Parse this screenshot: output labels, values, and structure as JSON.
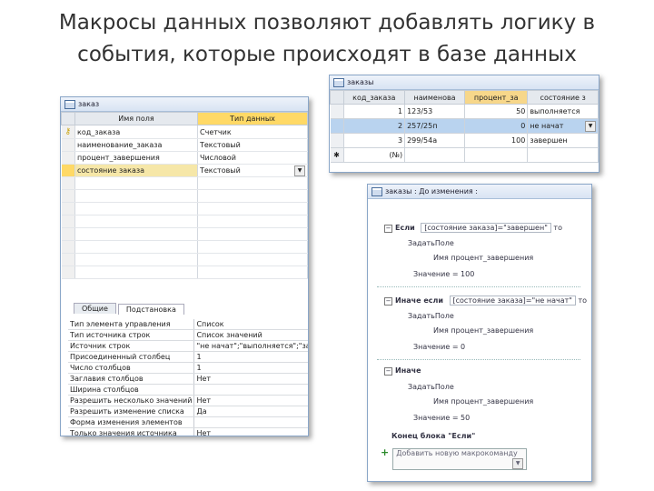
{
  "slide": {
    "title_line1": "Макросы данных позволяют добавлять логику в",
    "title_line2": "события, которые происходят в базе данных"
  },
  "design_view": {
    "title": "заказ",
    "col_field": "Имя поля",
    "col_type": "Тип данных",
    "rows": [
      {
        "field": "код_заказа",
        "type": "Счетчик"
      },
      {
        "field": "наименование_заказа",
        "type": "Текстовый"
      },
      {
        "field": "процент_завершения",
        "type": "Числовой"
      },
      {
        "field": "состояние заказа",
        "type": "Текстовый"
      }
    ],
    "tab_general": "Общие",
    "tab_lookup": "Подстановка",
    "properties": [
      {
        "name": "Тип элемента управления",
        "value": "Список"
      },
      {
        "name": "Тип источника строк",
        "value": "Список значений"
      },
      {
        "name": "Источник строк",
        "value": "\"не начат\";\"выполняется\";\"завершен\""
      },
      {
        "name": "Присоединенный столбец",
        "value": "1"
      },
      {
        "name": "Число столбцов",
        "value": "1"
      },
      {
        "name": "Заглавия столбцов",
        "value": "Нет"
      },
      {
        "name": "Ширина столбцов",
        "value": ""
      },
      {
        "name": "Разрешить несколько значений",
        "value": "Нет"
      },
      {
        "name": "Разрешить изменение списка",
        "value": "Да"
      },
      {
        "name": "Форма изменения элементов",
        "value": ""
      },
      {
        "name": "Только значения источника",
        "value": "Нет"
      }
    ]
  },
  "datasheet": {
    "title": "заказы",
    "headers": [
      "код_заказа",
      "наименова",
      "процент_за",
      "состояние з"
    ],
    "rows": [
      {
        "id": "1",
        "name": "123/53",
        "pct": "50",
        "state": "выполняется"
      },
      {
        "id": "2",
        "name": "257/25п",
        "pct": "0",
        "state": "не начат"
      },
      {
        "id": "3",
        "name": "299/54а",
        "pct": "100",
        "state": "завершен"
      }
    ],
    "new_row_marker": "(№)"
  },
  "macro": {
    "title": "заказы : До изменения :",
    "if_label": "Если",
    "if_cond": "[состояние заказа]=\"завершен\"",
    "then": "то",
    "setfield": "ЗадатьПоле",
    "name_label": "Имя",
    "name_value": "процент_завершения",
    "value_label": "Значение",
    "value1": "= 100",
    "elseif_label": "Иначе если",
    "elseif_cond": "[состояние заказа]=\"не начат\"",
    "value2": "= 0",
    "else_label": "Иначе",
    "value3": "= 50",
    "end_label": "Конец блока \"Если\"",
    "add_action": "Добавить новую макрокоманду"
  }
}
